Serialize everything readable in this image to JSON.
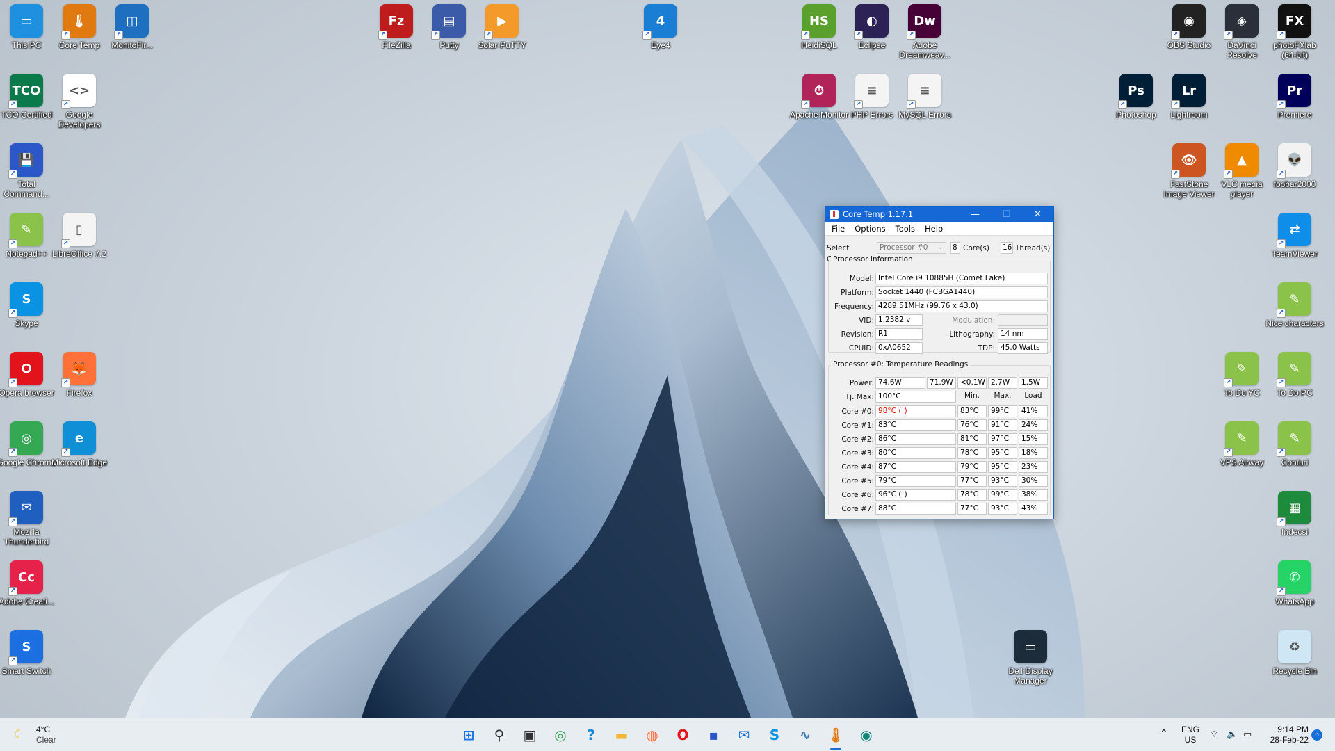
{
  "desktop_icons": [
    {
      "id": "this-pc",
      "label": "This PC",
      "color": "#1f8fe0",
      "glyph": "▭"
    },
    {
      "id": "core-temp",
      "label": "Core Temp",
      "color": "#e07a10",
      "glyph": "🌡"
    },
    {
      "id": "monitorfire",
      "label": "MonitoFir...",
      "color": "#1f6fc0",
      "glyph": "◫"
    },
    {
      "id": "filezilla",
      "label": "FileZilla",
      "color": "#bf1d1d",
      "glyph": "Fz"
    },
    {
      "id": "putty",
      "label": "Putty",
      "color": "#3b5ba8",
      "glyph": "▤"
    },
    {
      "id": "solar-putty",
      "label": "Solar-PuTTY",
      "color": "#f39a2b",
      "glyph": "▶"
    },
    {
      "id": "eye4",
      "label": "Eye4",
      "color": "#1a7fd4",
      "glyph": "4"
    },
    {
      "id": "heidisql",
      "label": "HeidiSQL",
      "color": "#5aa02c",
      "glyph": "HS"
    },
    {
      "id": "eclipse",
      "label": "Eclipse",
      "color": "#2c2255",
      "glyph": "◐"
    },
    {
      "id": "dreamweaver",
      "label": "Adobe Dreamweav...",
      "color": "#470137",
      "glyph": "Dw"
    },
    {
      "id": "obs",
      "label": "OBS Studio",
      "color": "#222222",
      "glyph": "◉"
    },
    {
      "id": "davinci",
      "label": "DaVinci Resolve",
      "color": "#2a2f3a",
      "glyph": "◈"
    },
    {
      "id": "photofxlab",
      "label": "photoFXlab (64-bit)",
      "color": "#111111",
      "glyph": "FX"
    },
    {
      "id": "tco",
      "label": "TCO Certified",
      "color": "#0a7a4a",
      "glyph": "TCO"
    },
    {
      "id": "google-dev",
      "label": "Google Developers",
      "color": "#ffffff",
      "glyph": "<>"
    },
    {
      "id": "apache",
      "label": "Apache Monitor",
      "color": "#b0245a",
      "glyph": "⏱"
    },
    {
      "id": "php-errors",
      "label": "PHP Errors",
      "color": "#f4f4f4",
      "glyph": "≡"
    },
    {
      "id": "mysql-errors",
      "label": "MySQL Errors",
      "color": "#f4f4f4",
      "glyph": "≡"
    },
    {
      "id": "photoshop",
      "label": "Photoshop",
      "color": "#001e36",
      "glyph": "Ps"
    },
    {
      "id": "lightroom",
      "label": "Lightroom",
      "color": "#001e36",
      "glyph": "Lr"
    },
    {
      "id": "premiere",
      "label": "Premiere",
      "color": "#00005b",
      "glyph": "Pr"
    },
    {
      "id": "total-commander",
      "label": "Total Command...",
      "color": "#2b57c9",
      "glyph": "💾"
    },
    {
      "id": "faststone",
      "label": "FastStone Image Viewer",
      "color": "#cc5522",
      "glyph": "👁"
    },
    {
      "id": "vlc",
      "label": "VLC media player",
      "color": "#f08a00",
      "glyph": "▲"
    },
    {
      "id": "foobar",
      "label": "foobar2000",
      "color": "#f2f2f2",
      "glyph": "👽"
    },
    {
      "id": "notepadpp",
      "label": "Notepad++",
      "color": "#8bc34a",
      "glyph": "✎"
    },
    {
      "id": "libreoffice",
      "label": "LibreOffice 7.2",
      "color": "#f4f4f4",
      "glyph": "▯"
    },
    {
      "id": "teamviewer",
      "label": "TeamViewer",
      "color": "#0e8ee9",
      "glyph": "⇄"
    },
    {
      "id": "nice-characters",
      "label": "Nice characters",
      "color": "#8bc34a",
      "glyph": "✎"
    },
    {
      "id": "skype",
      "label": "Skype",
      "color": "#0a93e2",
      "glyph": "S"
    },
    {
      "id": "to-do-yc",
      "label": "To Do YC",
      "color": "#8bc34a",
      "glyph": "✎"
    },
    {
      "id": "to-do-pc",
      "label": "To Do PC",
      "color": "#8bc34a",
      "glyph": "✎"
    },
    {
      "id": "opera",
      "label": "Opera browser",
      "color": "#e3131b",
      "glyph": "O"
    },
    {
      "id": "firefox",
      "label": "Firefox",
      "color": "#ff7139",
      "glyph": "🦊"
    },
    {
      "id": "chrome",
      "label": "Google Chrome",
      "color": "#34a853",
      "glyph": "◎"
    },
    {
      "id": "edge",
      "label": "Microsoft Edge",
      "color": "#0f8fd6",
      "glyph": "e"
    },
    {
      "id": "vps-airway",
      "label": "VPS Airway",
      "color": "#8bc34a",
      "glyph": "✎"
    },
    {
      "id": "conturi",
      "label": "Conturi",
      "color": "#8bc34a",
      "glyph": "✎"
    },
    {
      "id": "thunderbird",
      "label": "Mozilla Thunderbird",
      "color": "#1f5fbf",
      "glyph": "✉"
    },
    {
      "id": "indecsi",
      "label": "Indecsi",
      "color": "#1e8a3c",
      "glyph": "▦"
    },
    {
      "id": "adobe-cc",
      "label": "Adobe Creati...",
      "color": "#e6224a",
      "glyph": "Cc"
    },
    {
      "id": "whatsapp",
      "label": "WhatsApp",
      "color": "#25d366",
      "glyph": "✆"
    },
    {
      "id": "smart-switch",
      "label": "Smart Switch",
      "color": "#1b6fe0",
      "glyph": "S"
    },
    {
      "id": "dell-display",
      "label": "Dell Display Manager",
      "color": "#1d2c3a",
      "glyph": "▭"
    },
    {
      "id": "recycle-bin",
      "label": "Recycle Bin",
      "color": "#cfe6f5",
      "glyph": "♻"
    }
  ],
  "coretemp": {
    "title": "Core Temp 1.17.1",
    "menu": [
      "File",
      "Options",
      "Tools",
      "Help"
    ],
    "select_cpu_label": "Select CPU:",
    "processor_select": "Processor #0",
    "cores": "8",
    "cores_label": "Core(s)",
    "threads": "16",
    "threads_label": "Thread(s)",
    "info_group": "Processor Information",
    "model_label": "Model:",
    "model": "Intel Core i9 10885H (Comet Lake)",
    "platform_label": "Platform:",
    "platform": "Socket 1440 (FCBGA1440)",
    "frequency_label": "Frequency:",
    "frequency": "4289.51MHz (99.76 x 43.0)",
    "vid_label": "VID:",
    "vid": "1.2382 v",
    "modulation_label": "Modulation:",
    "modulation": "",
    "revision_label": "Revision:",
    "revision": "R1",
    "lithography_label": "Lithography:",
    "lithography": "14 nm",
    "cpuid_label": "CPUID:",
    "cpuid": "0xA0652",
    "tdp_label": "TDP:",
    "tdp": "45.0 Watts",
    "temp_group": "Processor #0: Temperature Readings",
    "power_label": "Power:",
    "power": [
      "74.6W",
      "71.9W",
      "<0.1W",
      "2.7W",
      "1.5W"
    ],
    "tjmax_label": "Tj. Max:",
    "tjmax": "100°C",
    "col_min": "Min.",
    "col_max": "Max.",
    "col_load": "Load",
    "cores_rows": [
      {
        "label": "Core #0:",
        "temp": "98°C (!)",
        "min": "83°C",
        "max": "99°C",
        "load": "41%",
        "hot": true
      },
      {
        "label": "Core #1:",
        "temp": "83°C",
        "min": "76°C",
        "max": "91°C",
        "load": "24%",
        "hot": false
      },
      {
        "label": "Core #2:",
        "temp": "86°C",
        "min": "81°C",
        "max": "97°C",
        "load": "15%",
        "hot": false
      },
      {
        "label": "Core #3:",
        "temp": "80°C",
        "min": "78°C",
        "max": "95°C",
        "load": "18%",
        "hot": false
      },
      {
        "label": "Core #4:",
        "temp": "87°C",
        "min": "79°C",
        "max": "95°C",
        "load": "23%",
        "hot": false
      },
      {
        "label": "Core #5:",
        "temp": "79°C",
        "min": "77°C",
        "max": "93°C",
        "load": "30%",
        "hot": false
      },
      {
        "label": "Core #6:",
        "temp": "96°C (!)",
        "min": "78°C",
        "max": "99°C",
        "load": "38%",
        "hot": false
      },
      {
        "label": "Core #7:",
        "temp": "88°C",
        "min": "77°C",
        "max": "93°C",
        "load": "43%",
        "hot": false
      }
    ]
  },
  "taskbar": {
    "weather_temp": "4°C",
    "weather_desc": "Clear",
    "apps": [
      {
        "id": "start",
        "glyph": "⊞",
        "color": "#1a73e8"
      },
      {
        "id": "search",
        "glyph": "⚲",
        "color": "#333333"
      },
      {
        "id": "task-view",
        "glyph": "▣",
        "color": "#333333"
      },
      {
        "id": "chrome",
        "glyph": "◎",
        "color": "#34a853"
      },
      {
        "id": "help",
        "glyph": "?",
        "color": "#1a8ad8"
      },
      {
        "id": "file-explorer",
        "glyph": "▬",
        "color": "#f2b632"
      },
      {
        "id": "firefox",
        "glyph": "◍",
        "color": "#ff7139"
      },
      {
        "id": "opera",
        "glyph": "O",
        "color": "#e3131b"
      },
      {
        "id": "total-commander",
        "glyph": "▪",
        "color": "#2b57c9"
      },
      {
        "id": "mail",
        "glyph": "✉",
        "color": "#1d6fd0"
      },
      {
        "id": "skype",
        "glyph": "S",
        "color": "#0a93e2"
      },
      {
        "id": "performance",
        "glyph": "∿",
        "color": "#4a7fb3"
      },
      {
        "id": "core-temp",
        "glyph": "🌡",
        "color": "#e07a10"
      },
      {
        "id": "globe-app",
        "glyph": "◉",
        "color": "#0f8a7a"
      }
    ],
    "lang_top": "ENG",
    "lang_bottom": "US",
    "time": "9:14 PM",
    "date": "28-Feb-22",
    "notifications": "6"
  }
}
